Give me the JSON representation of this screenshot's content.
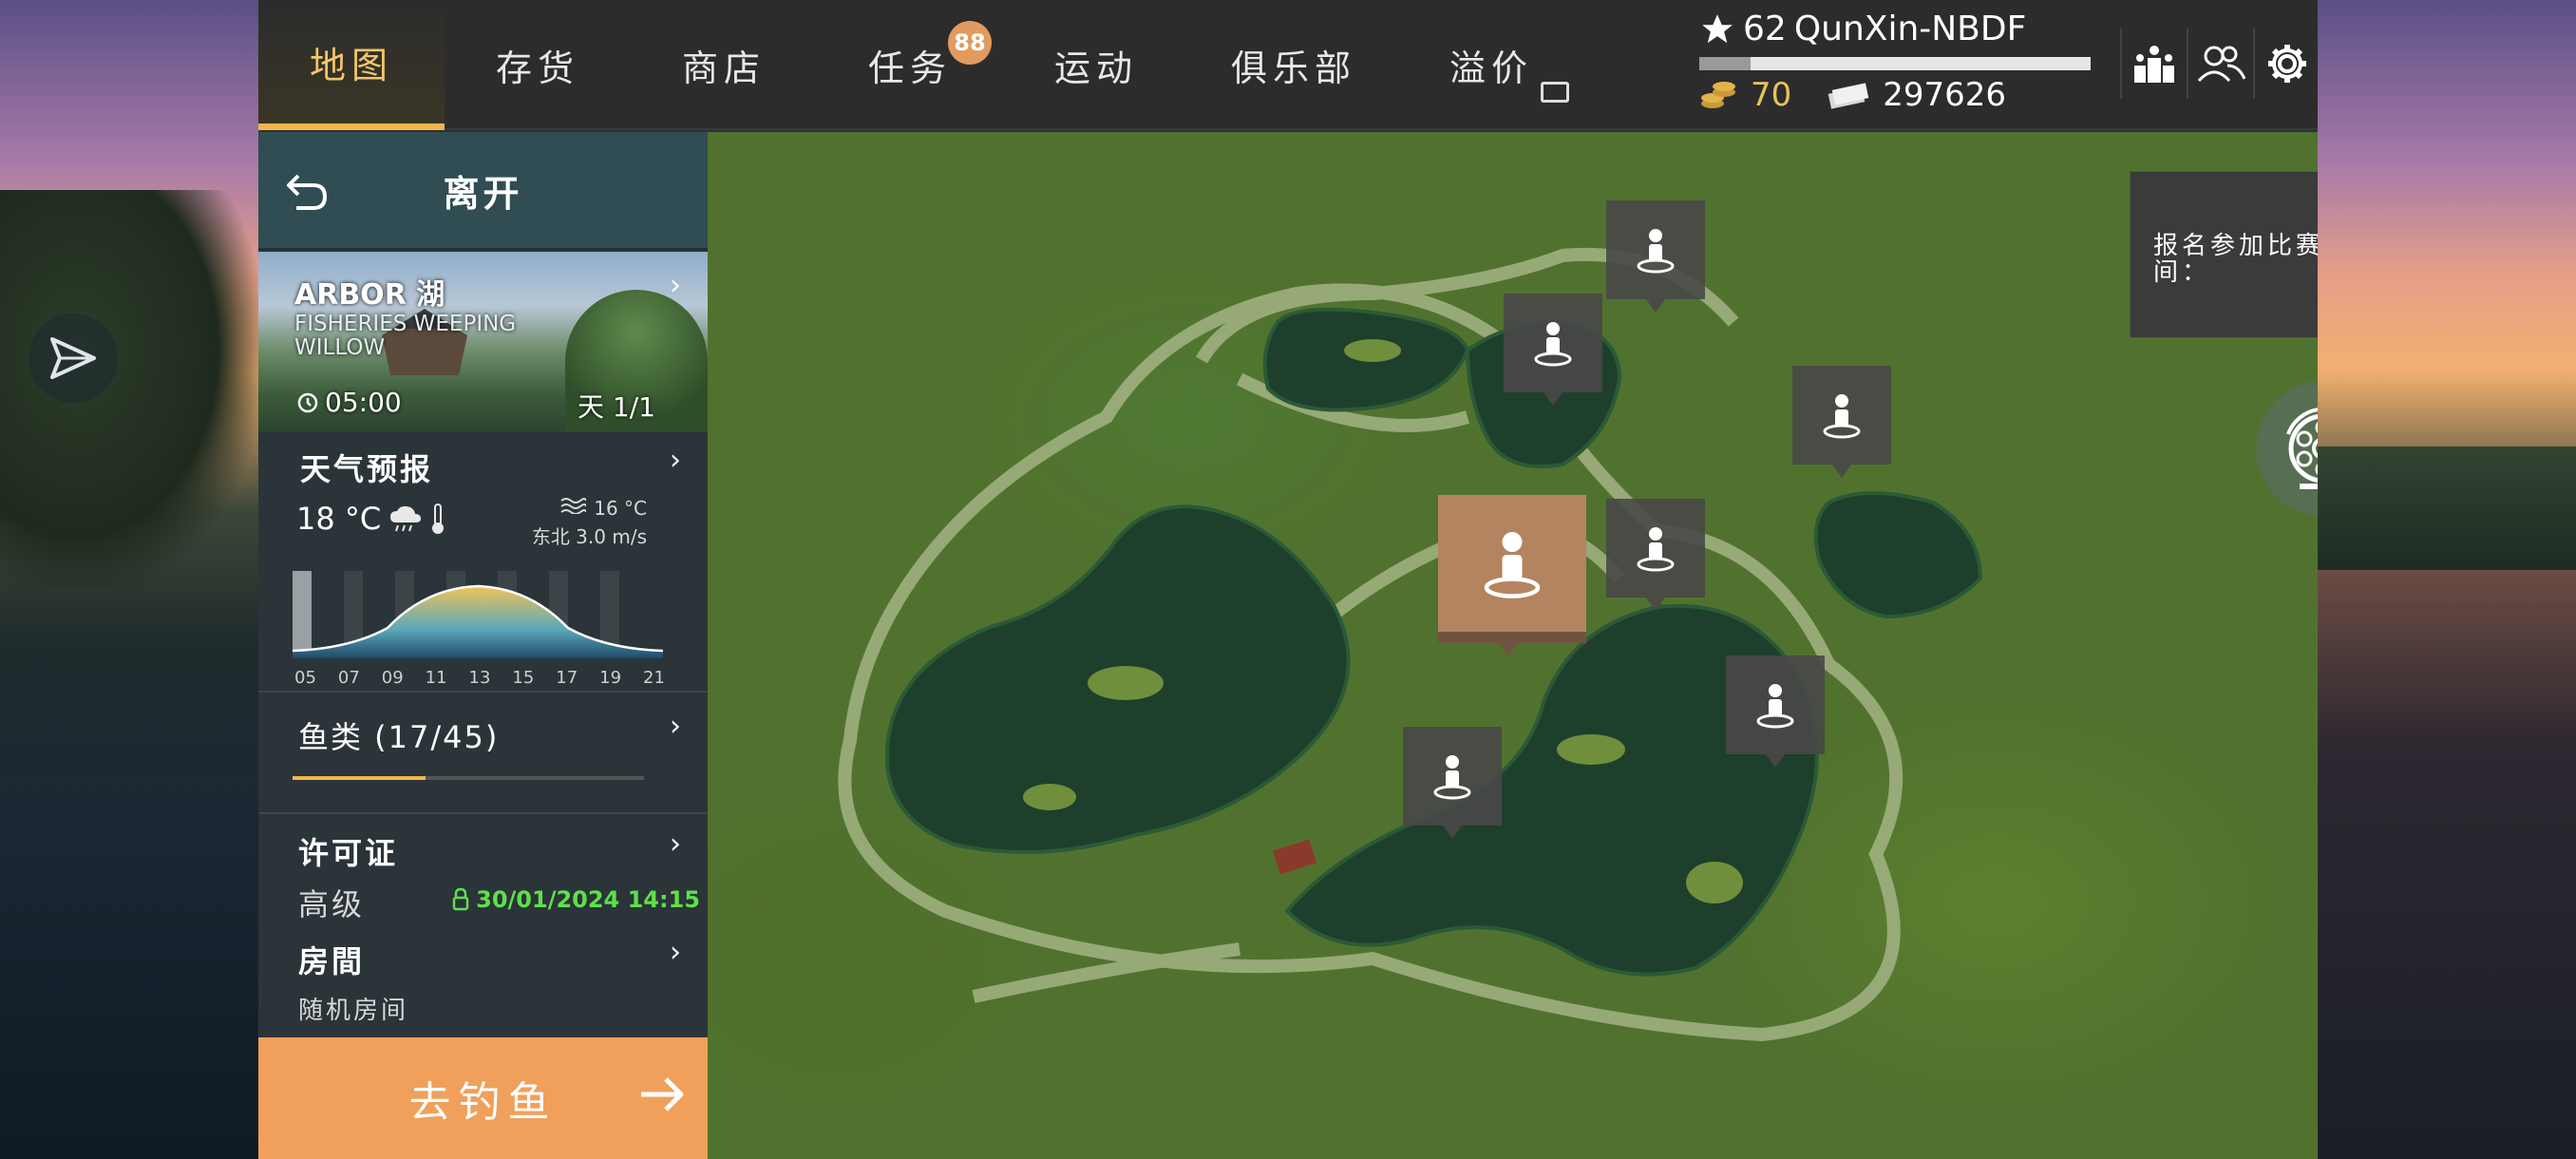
{
  "tabs": [
    {
      "label": "地图",
      "active": true
    },
    {
      "label": "存货"
    },
    {
      "label": "商店"
    },
    {
      "label": "任务",
      "badge": "88"
    },
    {
      "label": "运动"
    },
    {
      "label": "俱乐部"
    },
    {
      "label": "溢价"
    }
  ],
  "player": {
    "level": "62",
    "name": "QunXin-NBDF",
    "xp_fraction": 0.13,
    "coins": "70",
    "cash": "297626"
  },
  "top_icons": [
    "leaderboard-icon",
    "friends-icon",
    "settings-icon"
  ],
  "leave": {
    "label": "离开"
  },
  "lake": {
    "name": "ARBOR 湖",
    "subtitle": "FISHERIES WEEPING WILLOW",
    "time": "05:00",
    "day": "天 1/1"
  },
  "weather": {
    "title": "天气预报",
    "air_temp": "18 °C",
    "water_temp": "16 °C",
    "wind": "东北 3.0 m/s",
    "hours": [
      "05",
      "07",
      "09",
      "11",
      "13",
      "15",
      "17",
      "19",
      "21"
    ]
  },
  "fish": {
    "label": "鱼类 (17/45)",
    "progress": 0.378
  },
  "license": {
    "title": "许可证",
    "level": "高级",
    "expires": "30/01/2024 14:15"
  },
  "room": {
    "title": "房間",
    "value": "随机房间"
  },
  "go_fishing": {
    "label": "去钓鱼"
  },
  "competition": {
    "text": "报名参加比赛时间："
  },
  "colors": {
    "accent": "#f2b64b",
    "go_button": "#f0a05a",
    "license_green": "#5ee04a",
    "selected_spot": "#b48460"
  }
}
